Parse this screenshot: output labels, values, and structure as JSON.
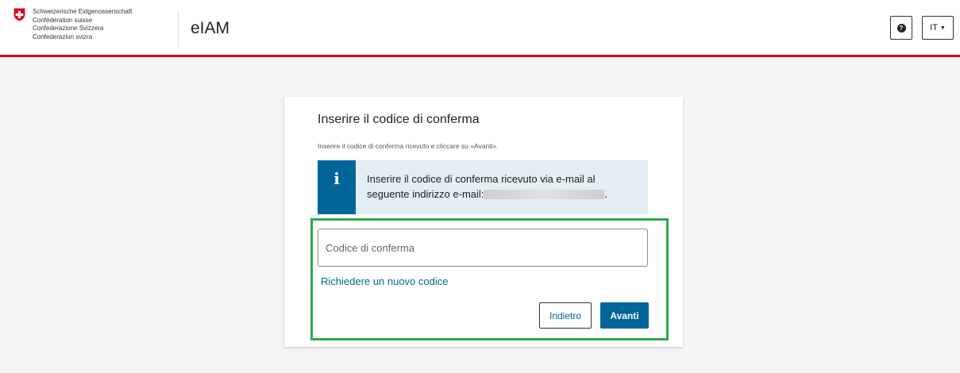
{
  "header": {
    "federation_lines": [
      "Schweizerische Eidgenossenschaft",
      "Confédération suisse",
      "Confederazione Svizzera",
      "Confederaziun svizra"
    ],
    "app_name": "eIAM",
    "help_icon": "question-circle-icon",
    "language_label": "IT",
    "brand_color": "#dc0018"
  },
  "card": {
    "title": "Inserire il codice di conferma",
    "subtitle": "Inserire il codice di conferma ricevuto e cliccare su «Avanti».",
    "info": {
      "icon": "info-icon",
      "line1": "Inserire il codice di conferma ricevuto via e-mail al",
      "line2_prefix": "seguente indirizzo e-mail:",
      "line2_suffix": ".",
      "color": "#006699"
    },
    "code_placeholder": "Codice di conferma",
    "code_value": "",
    "request_new_code": "Richiedere un nuovo codice",
    "back_label": "Indietro",
    "next_label": "Avanti",
    "highlight_color": "#2eaa4a"
  }
}
